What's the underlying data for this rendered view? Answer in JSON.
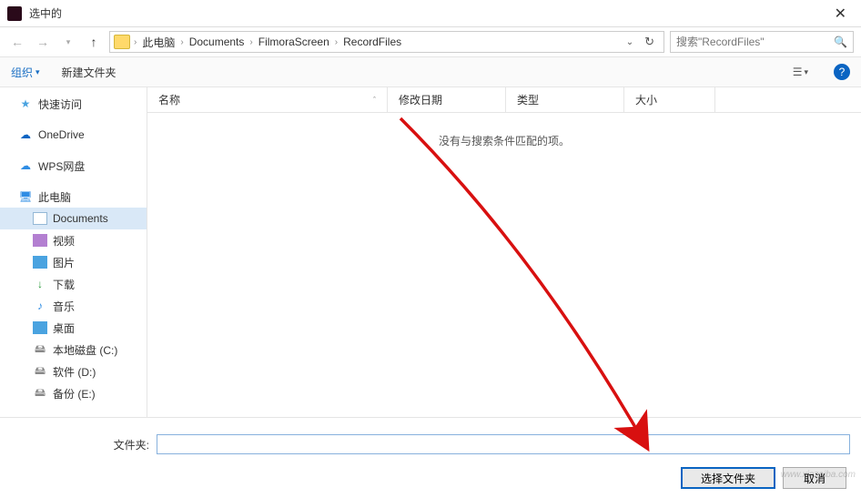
{
  "window": {
    "title": "选中的"
  },
  "breadcrumb": {
    "items": [
      "此电脑",
      "Documents",
      "FilmoraScreen",
      "RecordFiles"
    ]
  },
  "search": {
    "placeholder": "搜索\"RecordFiles\""
  },
  "toolbar": {
    "organize": "组织",
    "newfolder": "新建文件夹"
  },
  "columns": {
    "name": "名称",
    "date": "修改日期",
    "type": "类型",
    "size": "大小"
  },
  "empty_text": "没有与搜索条件匹配的项。",
  "sidebar": {
    "quick": "快速访问",
    "onedrive": "OneDrive",
    "wps": "WPS网盘",
    "pc": "此电脑",
    "documents": "Documents",
    "video": "视频",
    "pictures": "图片",
    "downloads": "下载",
    "music": "音乐",
    "desktop": "桌面",
    "drive_c": "本地磁盘 (C:)",
    "drive_d": "软件 (D:)",
    "drive_e": "备份 (E:)"
  },
  "footer": {
    "folder_label": "文件夹:",
    "select_btn": "选择文件夹",
    "cancel_btn": "取消"
  },
  "watermark": "www.xiazaiba.com"
}
